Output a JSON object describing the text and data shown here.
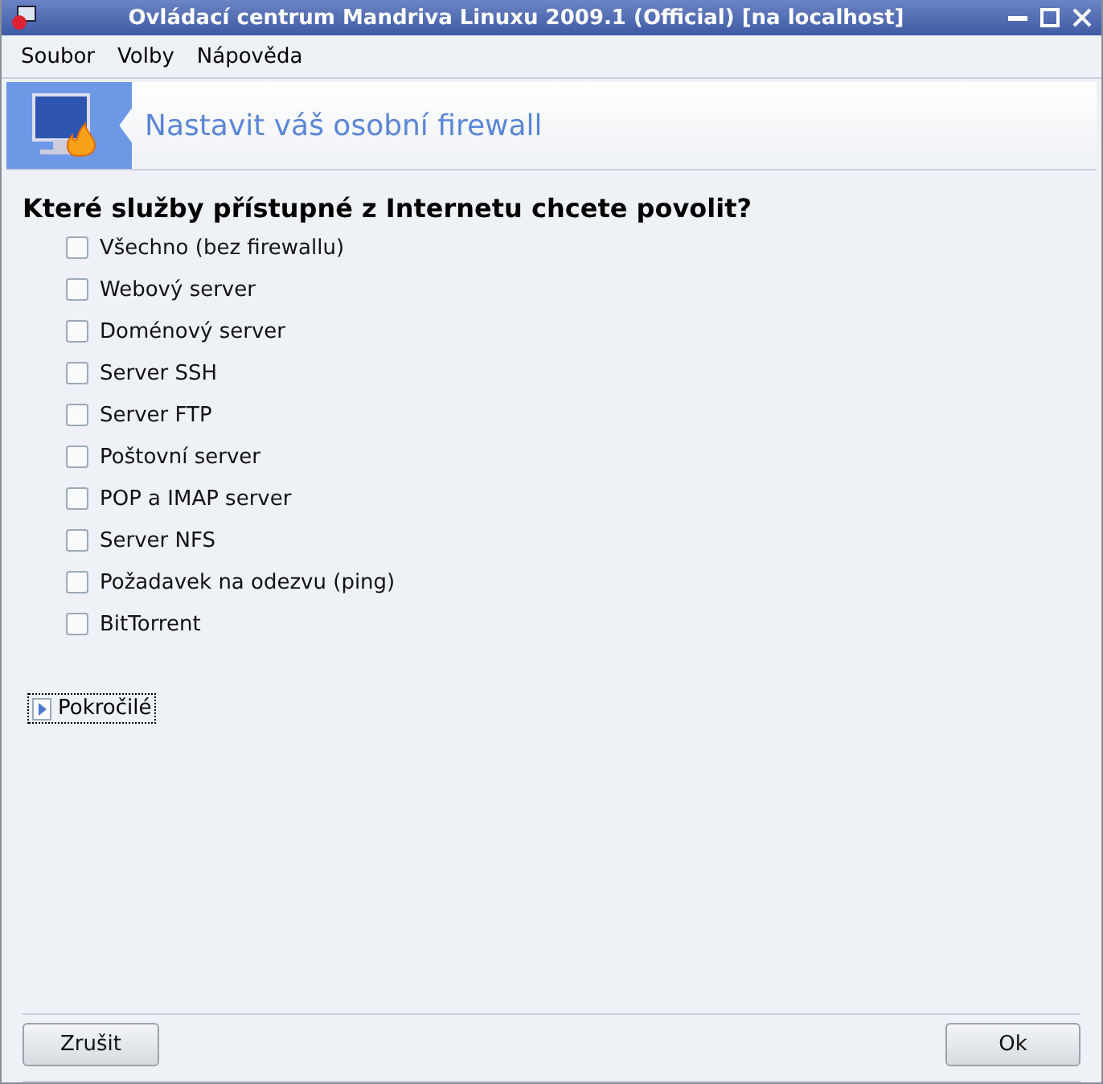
{
  "window": {
    "title": "Ovládací centrum Mandriva Linuxu 2009.1 (Official) [na localhost]"
  },
  "menu": [
    "Soubor",
    "Volby",
    "Nápověda"
  ],
  "header": {
    "title": "Nastavit váš osobní firewall"
  },
  "question": "Které služby přístupné z Internetu chcete povolit?",
  "services": [
    {
      "label": "Všechno (bez firewallu)",
      "checked": false
    },
    {
      "label": "Webový server",
      "checked": false
    },
    {
      "label": "Doménový server",
      "checked": false
    },
    {
      "label": "Server SSH",
      "checked": false
    },
    {
      "label": "Server FTP",
      "checked": false
    },
    {
      "label": "Poštovní server",
      "checked": false
    },
    {
      "label": "POP a IMAP server",
      "checked": false
    },
    {
      "label": "Server NFS",
      "checked": false
    },
    {
      "label": "Požadavek na odezvu (ping)",
      "checked": false
    },
    {
      "label": "BitTorrent",
      "checked": false
    }
  ],
  "advanced": {
    "label": "Pokročilé",
    "expanded": false
  },
  "buttons": [
    {
      "label": "Zrušit",
      "kind": "cancel"
    },
    {
      "label": "Ok",
      "kind": "ok"
    }
  ]
}
